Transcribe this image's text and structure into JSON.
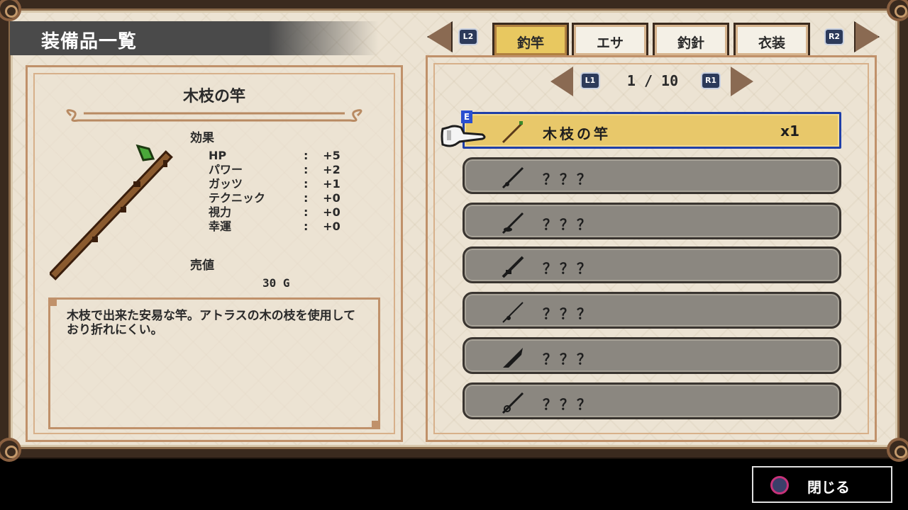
{
  "header": {
    "title": "装備品一覧"
  },
  "tabs": {
    "left_button": "L2",
    "right_button": "R2",
    "items": [
      {
        "label": "釣竿",
        "active": true
      },
      {
        "label": "エサ",
        "active": false
      },
      {
        "label": "釣針",
        "active": false
      },
      {
        "label": "衣装",
        "active": false
      }
    ]
  },
  "detail": {
    "name": "木枝の竿",
    "effect_label": "効果",
    "stats": [
      {
        "name": "HP",
        "colon": ":",
        "value": "+5"
      },
      {
        "name": "パワー",
        "colon": ":",
        "value": "+2"
      },
      {
        "name": "ガッツ",
        "colon": ":",
        "value": "+1"
      },
      {
        "name": "テクニック",
        "colon": ":",
        "value": "+0"
      },
      {
        "name": "視力",
        "colon": ":",
        "value": "+0"
      },
      {
        "name": "幸運",
        "colon": ":",
        "value": "+0"
      }
    ],
    "price_label": "売値",
    "price": "30 G",
    "description": "木枝で出来た安易な竿。アトラスの木の枝を使用しており折れにくい。"
  },
  "pager": {
    "left_button": "L1",
    "right_button": "R1",
    "text": "1 / 10"
  },
  "list": {
    "new_badge": "E",
    "rows": [
      {
        "name": "木枝の竿",
        "qty": "x1",
        "selected": true,
        "icon": "twig-rod-icon"
      },
      {
        "name": "？？？",
        "qty": "",
        "selected": false,
        "icon": "rod-silhouette-icon"
      },
      {
        "name": "？？？",
        "qty": "",
        "selected": false,
        "icon": "rod-silhouette-icon"
      },
      {
        "name": "？？？",
        "qty": "",
        "selected": false,
        "icon": "rod-silhouette-icon"
      },
      {
        "name": "？？？",
        "qty": "",
        "selected": false,
        "icon": "rod-silhouette-icon"
      },
      {
        "name": "？？？",
        "qty": "",
        "selected": false,
        "icon": "rod-silhouette-icon"
      },
      {
        "name": "？？？",
        "qty": "",
        "selected": false,
        "icon": "rod-silhouette-icon"
      }
    ]
  },
  "footer": {
    "close_label": "閉じる"
  },
  "colors": {
    "selected_row": "#e8c86a",
    "locked_row": "#8b8780",
    "active_tab": "#e8c860",
    "selection_border": "#1f3fa8"
  }
}
